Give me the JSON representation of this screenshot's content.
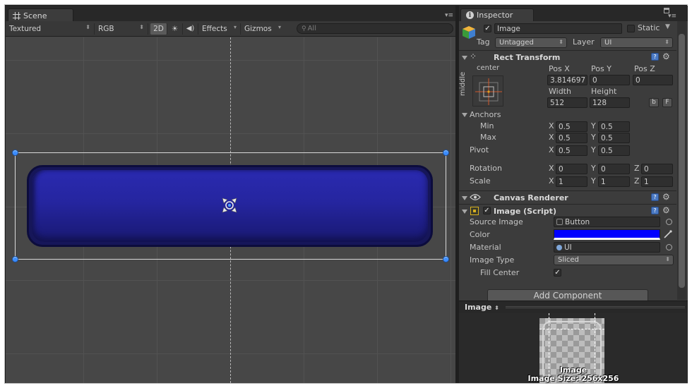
{
  "scene": {
    "tab_label": "Scene",
    "toolbar": {
      "draw_mode": "Textured",
      "color_mode": "RGB",
      "mode_2d": "2D",
      "effects": "Effects",
      "gizmos": "Gizmos",
      "search_placeholder": "All"
    }
  },
  "inspector": {
    "tab_label": "Inspector",
    "object": {
      "name": "Image",
      "active": true,
      "static_label": "Static",
      "tag_label": "Tag",
      "tag_value": "Untagged",
      "layer_label": "Layer",
      "layer_value": "UI"
    },
    "rect_transform": {
      "title": "Rect Transform",
      "anchor_h": "center",
      "anchor_v": "middle",
      "pos_x_label": "Pos X",
      "pos_y_label": "Pos Y",
      "pos_z_label": "Pos Z",
      "pos_x": "3.814697",
      "pos_y": "0",
      "pos_z": "0",
      "width_label": "Width",
      "height_label": "Height",
      "width": "512",
      "height": "128",
      "blueprint_btn": "b",
      "raw_btn": "F",
      "anchors_label": "Anchors",
      "min_label": "Min",
      "max_label": "Max",
      "min_x": "0.5",
      "min_y": "0.5",
      "max_x": "0.5",
      "max_y": "0.5",
      "pivot_label": "Pivot",
      "pivot_x": "0.5",
      "pivot_y": "0.5",
      "rotation_label": "Rotation",
      "rot_x": "0",
      "rot_y": "0",
      "rot_z": "0",
      "scale_label": "Scale",
      "scale_x": "1",
      "scale_y": "1",
      "scale_z": "1",
      "x": "X",
      "y": "Y",
      "z": "Z"
    },
    "canvas_renderer": {
      "title": "Canvas Renderer"
    },
    "image_script": {
      "title": "Image (Script)",
      "enabled": true,
      "source_image_label": "Source Image",
      "source_image_value": "Button",
      "color_label": "Color",
      "color_value": "#0000ff",
      "material_label": "Material",
      "material_value": "UI",
      "image_type_label": "Image Type",
      "image_type_value": "Sliced",
      "fill_center_label": "Fill Center",
      "fill_center": true
    },
    "add_component": "Add Component",
    "preview": {
      "title": "Image",
      "caption_name": "Image",
      "caption_size": "Image Size: 256x256"
    }
  }
}
